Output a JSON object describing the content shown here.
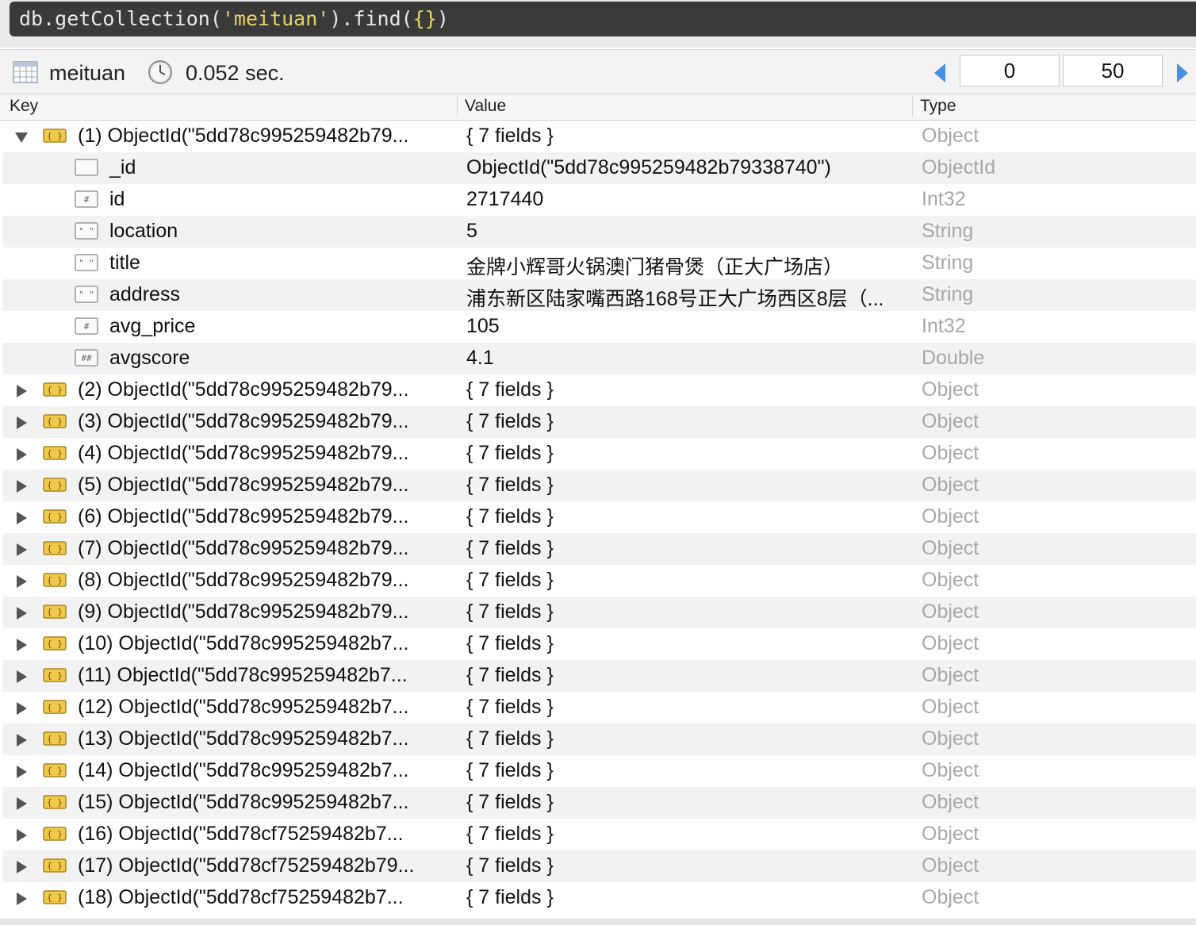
{
  "query": {
    "prefix": "db.getCollection(",
    "collection_arg": "'meituan'",
    "middle": ").find(",
    "filter": "{}",
    "suffix": ")"
  },
  "toolbar": {
    "collection_name": "meituan",
    "elapsed": "0.052 sec.",
    "skip": "0",
    "limit": "50"
  },
  "columns": {
    "key": "Key",
    "value": "Value",
    "type": "Type"
  },
  "documents": [
    {
      "key": "(1) ObjectId(\"5dd78c995259482b79...",
      "value": "{ 7 fields }",
      "type": "Object",
      "expanded": true,
      "fields": [
        {
          "icon": "objectid-field-icon",
          "key": "_id",
          "value": "ObjectId(\"5dd78c995259482b79338740\")",
          "type": "ObjectId"
        },
        {
          "icon": "int-field-icon",
          "key": "id",
          "value": "2717440",
          "type": "Int32"
        },
        {
          "icon": "string-field-icon",
          "key": "location",
          "value": "5",
          "type": "String"
        },
        {
          "icon": "string-field-icon",
          "key": "title",
          "value": "金牌小辉哥火锅澳门猪骨煲（正大广场店）",
          "type": "String"
        },
        {
          "icon": "string-field-icon",
          "key": "address",
          "value": "浦东新区陆家嘴西路168号正大广场西区8层（...",
          "type": "String"
        },
        {
          "icon": "int-field-icon",
          "key": "avg_price",
          "value": "105",
          "type": "Int32"
        },
        {
          "icon": "double-field-icon",
          "key": "avgscore",
          "value": "4.1",
          "type": "Double"
        }
      ]
    },
    {
      "key": "(2) ObjectId(\"5dd78c995259482b79...",
      "value": "{ 7 fields }",
      "type": "Object"
    },
    {
      "key": "(3) ObjectId(\"5dd78c995259482b79...",
      "value": "{ 7 fields }",
      "type": "Object"
    },
    {
      "key": "(4) ObjectId(\"5dd78c995259482b79...",
      "value": "{ 7 fields }",
      "type": "Object"
    },
    {
      "key": "(5) ObjectId(\"5dd78c995259482b79...",
      "value": "{ 7 fields }",
      "type": "Object"
    },
    {
      "key": "(6) ObjectId(\"5dd78c995259482b79...",
      "value": "{ 7 fields }",
      "type": "Object"
    },
    {
      "key": "(7) ObjectId(\"5dd78c995259482b79...",
      "value": "{ 7 fields }",
      "type": "Object"
    },
    {
      "key": "(8) ObjectId(\"5dd78c995259482b79...",
      "value": "{ 7 fields }",
      "type": "Object"
    },
    {
      "key": "(9) ObjectId(\"5dd78c995259482b79...",
      "value": "{ 7 fields }",
      "type": "Object"
    },
    {
      "key": "(10) ObjectId(\"5dd78c995259482b7...",
      "value": "{ 7 fields }",
      "type": "Object"
    },
    {
      "key": "(11) ObjectId(\"5dd78c995259482b7...",
      "value": "{ 7 fields }",
      "type": "Object"
    },
    {
      "key": "(12) ObjectId(\"5dd78c995259482b7...",
      "value": "{ 7 fields }",
      "type": "Object"
    },
    {
      "key": "(13) ObjectId(\"5dd78c995259482b7...",
      "value": "{ 7 fields }",
      "type": "Object"
    },
    {
      "key": "(14) ObjectId(\"5dd78c995259482b7...",
      "value": "{ 7 fields }",
      "type": "Object"
    },
    {
      "key": "(15) ObjectId(\"5dd78c995259482b7...",
      "value": "{ 7 fields }",
      "type": "Object"
    },
    {
      "key": "(16) ObjectId(\"5dd78cf75259482b7...",
      "value": "{ 7 fields }",
      "type": "Object"
    },
    {
      "key": "(17) ObjectId(\"5dd78cf75259482b79...",
      "value": "{ 7 fields }",
      "type": "Object"
    },
    {
      "key": "(18) ObjectId(\"5dd78cf75259482b7...",
      "value": "{ 7 fields }",
      "type": "Object"
    }
  ]
}
